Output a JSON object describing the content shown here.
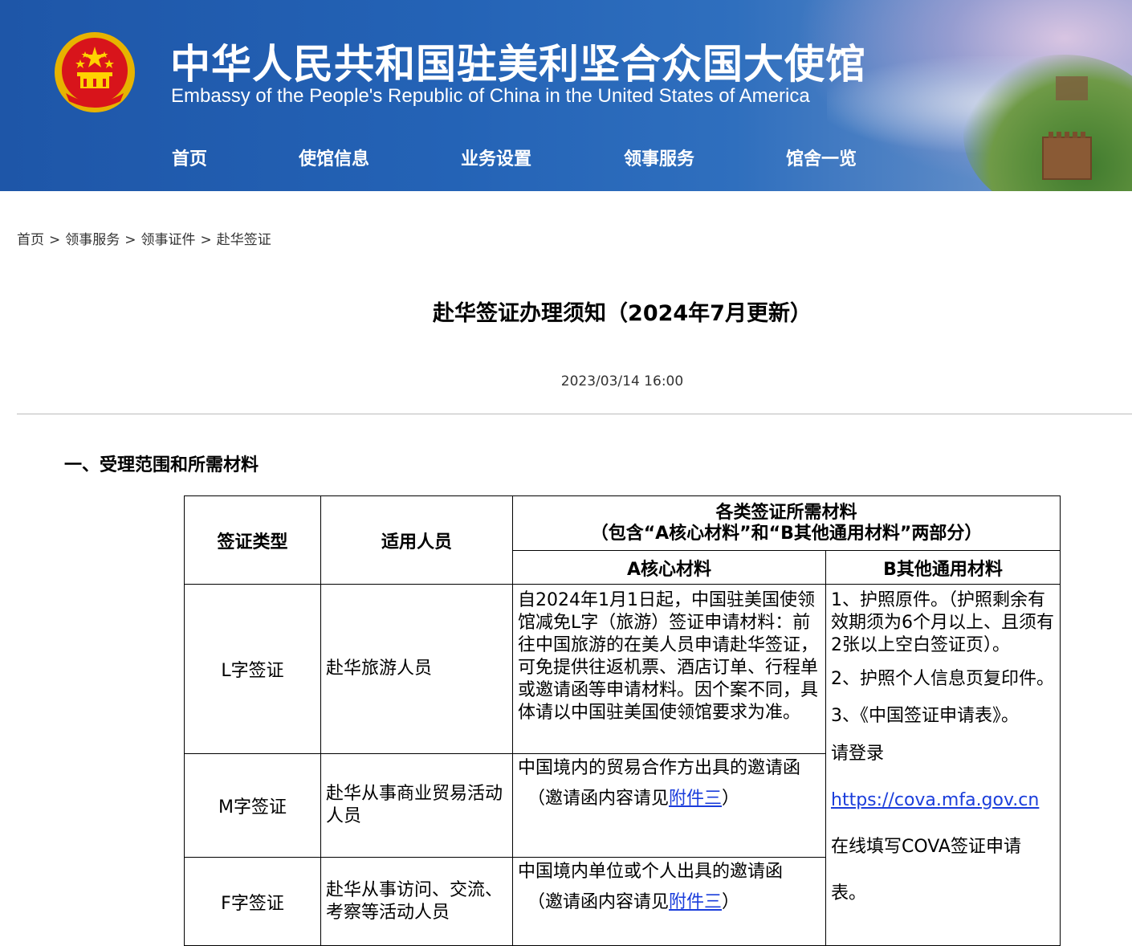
{
  "header": {
    "title_cn": "中华人民共和国驻美利坚合众国大使馆",
    "title_en": "Embassy of the People's Republic of China in the United States of America",
    "nav": [
      "首页",
      "使馆信息",
      "业务设置",
      "领事服务",
      "馆舍一览"
    ]
  },
  "breadcrumb": {
    "items": [
      "首页",
      "领事服务",
      "领事证件",
      "赴华签证"
    ],
    "separator": ">"
  },
  "article": {
    "title": "赴华签证办理须知（2024年7月更新）",
    "date": "2023/03/14 16:00",
    "section_heading": "一、受理范围和所需材料"
  },
  "table": {
    "headers": {
      "type": "签证类型",
      "who": "适用人员",
      "materials": "各类签证所需材料",
      "materials_sub": "（包含“A核心材料”和“B其他通用材料”两部分）",
      "a": "A核心材料",
      "b": "B其他通用材料"
    },
    "rows": [
      {
        "type": "L字签证",
        "who": "赴华旅游人员",
        "a": "自2024年1月1日起，中国驻美国使领馆减免L字（旅游）签证申请材料：前往中国旅游的在美人员申请赴华签证，可免提供往返机票、酒店订单、行程单或邀请函等申请材料。因个案不同，具体请以中国驻美国使领馆要求为准。"
      },
      {
        "type": "M字签证",
        "who": "赴华从事商业贸易活动人员",
        "a": "中国境内的贸易合作方出具的邀请函",
        "note_prefix": "（邀请函内容请见",
        "note_link": "附件三",
        "note_suffix": "）"
      },
      {
        "type": "F字签证",
        "who": "赴华从事访问、交流、考察等活动人员",
        "a": "中国境内单位或个人出具的邀请函",
        "note_prefix": "（邀请函内容请见",
        "note_link": "附件三",
        "note_suffix": "）"
      }
    ],
    "b_items": {
      "item1": "1、护照原件。（护照剩余有效期须为6个月以上、且须有2张以上空白签证页）。",
      "item2": "2、护照个人信息页复印件。",
      "item3": "3、《中国签证申请表》。",
      "item3_prefix": "请登录",
      "item3_link": "https://cova.mfa.gov.cn",
      "item3_suffix": "在线填写COVA签证申请表。"
    }
  },
  "colors": {
    "banner": "#2463b6",
    "link": "#1a3ddb",
    "divider": "#bbbbbb"
  }
}
